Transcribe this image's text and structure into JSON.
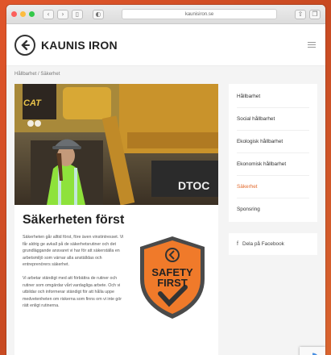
{
  "browser": {
    "url": "kaunisiron.se"
  },
  "site": {
    "brand": "KAUNIS IRON"
  },
  "breadcrumb": "Hållbarhet / Säkerhet",
  "article": {
    "title": "Säkerheten först",
    "paragraphs": [
      "Säkerheten går alltid först, före även vinstintresset. Vi får aldrig ge avkall på de säkerhetsrutiner och det grundläggande ansvaret vi har för att säkerställa en arbetsmiljö som värnar alla anställdas och entreprenörers säkerhet.",
      "Vi arbetar ständigt med att förbättra de rutiner och rutiner som omgärdar vårt vardagliga arbete. Och vi utbildar och informerar ständigt för att hålla uppe medvetenheten om riskerna som finns om vi inte gör rätt enligt rutinerna."
    ],
    "hero_sign": "CAT",
    "hero_truck_text": "DTOC",
    "badge": {
      "line1": "SAFETY",
      "line2": "FIRST"
    }
  },
  "sidebar": {
    "items": [
      {
        "label": "Hållbarhet"
      },
      {
        "label": "Social hållbarhet"
      },
      {
        "label": "Ekologisk hållbarhet"
      },
      {
        "label": "Ekonomisk hållbarhet"
      },
      {
        "label": "Säkerhet"
      },
      {
        "label": "Sponsring"
      }
    ],
    "share_label": "Dela på Facebook"
  },
  "colors": {
    "accent": "#e36a2c",
    "badge_orange": "#f07a2a"
  }
}
